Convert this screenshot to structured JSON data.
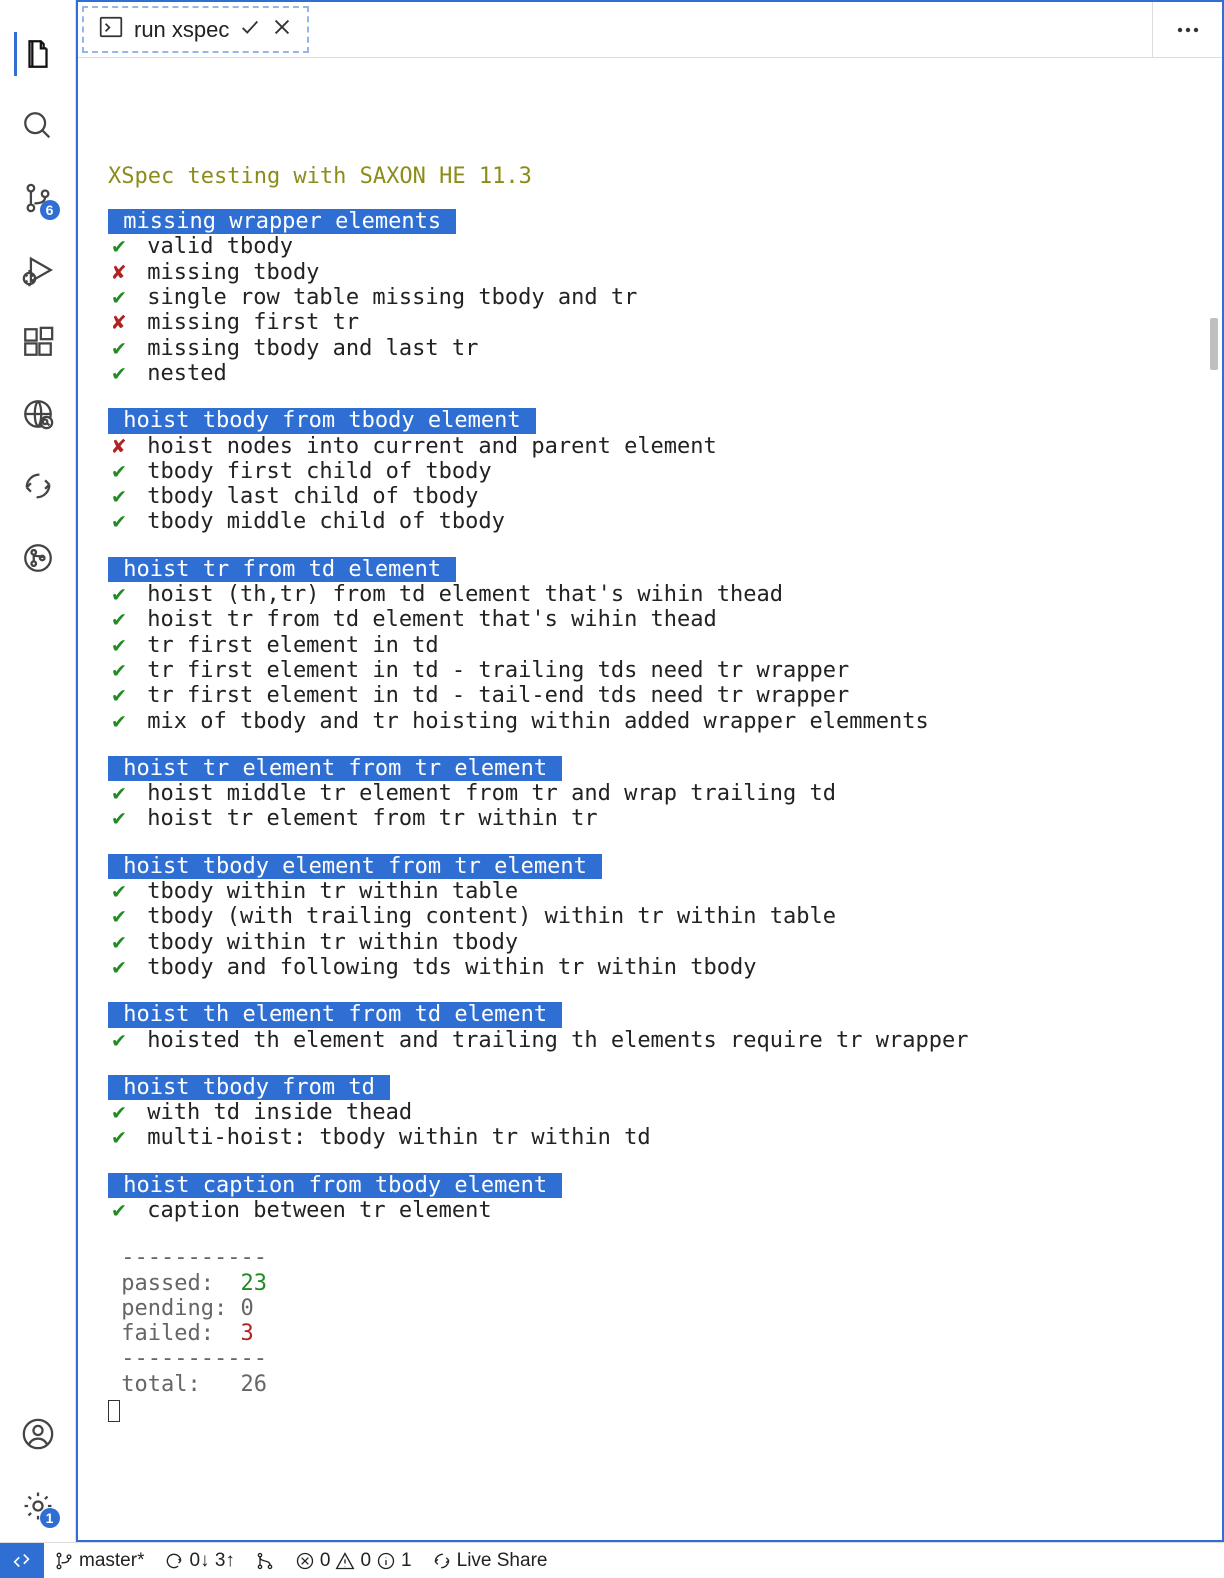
{
  "tab": {
    "label": "run xspec"
  },
  "scm_badge": "6",
  "settings_badge": "1",
  "terminal": {
    "title": "XSpec testing with SAXON HE 11.3",
    "groups": [
      {
        "header": " missing wrapper elements ",
        "tests": [
          {
            "status": "pass",
            "text": "valid tbody"
          },
          {
            "status": "fail",
            "text": "missing tbody"
          },
          {
            "status": "pass",
            "text": "single row table missing tbody and tr"
          },
          {
            "status": "fail",
            "text": "missing first tr"
          },
          {
            "status": "pass",
            "text": "missing tbody and last tr"
          },
          {
            "status": "pass",
            "text": "nested"
          }
        ]
      },
      {
        "header": " hoist tbody from tbody element ",
        "tests": [
          {
            "status": "fail",
            "text": "hoist nodes into current and parent element"
          },
          {
            "status": "pass",
            "text": "tbody first child of tbody"
          },
          {
            "status": "pass",
            "text": "tbody last child of tbody"
          },
          {
            "status": "pass",
            "text": "tbody middle child of tbody"
          }
        ]
      },
      {
        "header": " hoist tr from td element ",
        "tests": [
          {
            "status": "pass",
            "text": "hoist (th,tr) from td element that's wihin thead"
          },
          {
            "status": "pass",
            "text": "hoist tr from td element that's wihin thead"
          },
          {
            "status": "pass",
            "text": "tr first element in td"
          },
          {
            "status": "pass",
            "text": "tr first element in td - trailing tds need tr wrapper"
          },
          {
            "status": "pass",
            "text": "tr first element in td - tail-end tds need tr wrapper"
          },
          {
            "status": "pass",
            "text": "mix of tbody and tr hoisting within added wrapper elemments"
          }
        ]
      },
      {
        "header": " hoist tr element from tr element ",
        "tests": [
          {
            "status": "pass",
            "text": "hoist middle tr element from tr and wrap trailing td"
          },
          {
            "status": "pass",
            "text": "hoist tr element from tr within tr"
          }
        ]
      },
      {
        "header": " hoist tbody element from tr element ",
        "tests": [
          {
            "status": "pass",
            "text": "tbody within tr within table"
          },
          {
            "status": "pass",
            "text": "tbody (with trailing content) within tr within table"
          },
          {
            "status": "pass",
            "text": "tbody within tr within tbody"
          },
          {
            "status": "pass",
            "text": "tbody and following tds within tr within tbody"
          }
        ]
      },
      {
        "header": " hoist th element from td element ",
        "tests": [
          {
            "status": "pass",
            "text": "hoisted th element and trailing th elements require tr wrapper"
          }
        ]
      },
      {
        "header": " hoist tbody from td ",
        "tests": [
          {
            "status": "pass",
            "text": "with td inside thead"
          },
          {
            "status": "pass",
            "text": "multi-hoist: tbody within tr within td"
          }
        ]
      },
      {
        "header": " hoist caption from tbody element ",
        "tests": [
          {
            "status": "pass",
            "text": "caption between tr element"
          }
        ]
      }
    ],
    "summary": {
      "rule": "-----------",
      "passed_label": "passed:  ",
      "passed": "23",
      "pending_label": "pending: ",
      "pending": "0",
      "failed_label": "failed:  ",
      "failed": "3",
      "total_label": "total:   ",
      "total": "26"
    }
  },
  "status": {
    "branch": "master*",
    "sync": "0↓ 3↑",
    "errors": "0",
    "warnings": "0",
    "info": "1",
    "live_share": "Live Share"
  }
}
